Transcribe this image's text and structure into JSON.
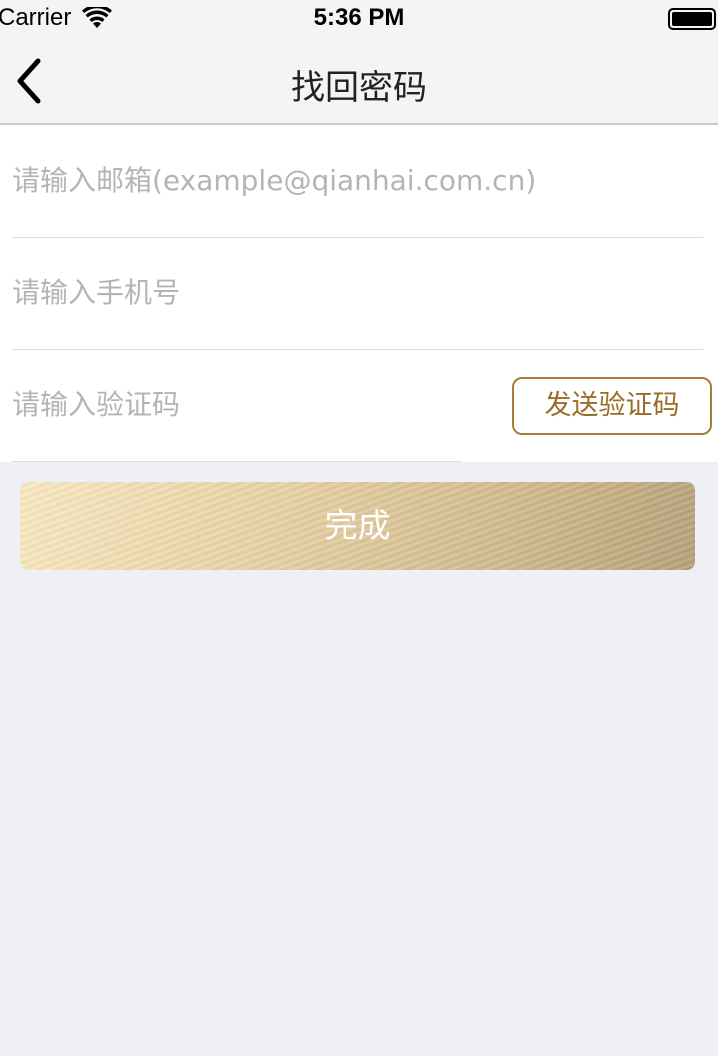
{
  "status_bar": {
    "carrier": "Carrier",
    "time": "5:36 PM",
    "wifi_icon": "wifi-icon",
    "battery_icon": "battery-icon"
  },
  "nav": {
    "title": "找回密码",
    "back_icon": "chevron-left-icon"
  },
  "form": {
    "email": {
      "placeholder": "请输入邮箱(example@qianhai.com.cn)",
      "value": ""
    },
    "phone": {
      "placeholder": "请输入手机号",
      "value": ""
    },
    "code": {
      "placeholder": "请输入验证码",
      "value": ""
    },
    "send_code_label": "发送验证码"
  },
  "submit_label": "完成",
  "colors": {
    "accent": "#a87c3c",
    "background": "#eff0f5",
    "nav_background": "#f4f4f5",
    "button_gradient": [
      "#f8e8c2",
      "#b7a07a"
    ]
  }
}
